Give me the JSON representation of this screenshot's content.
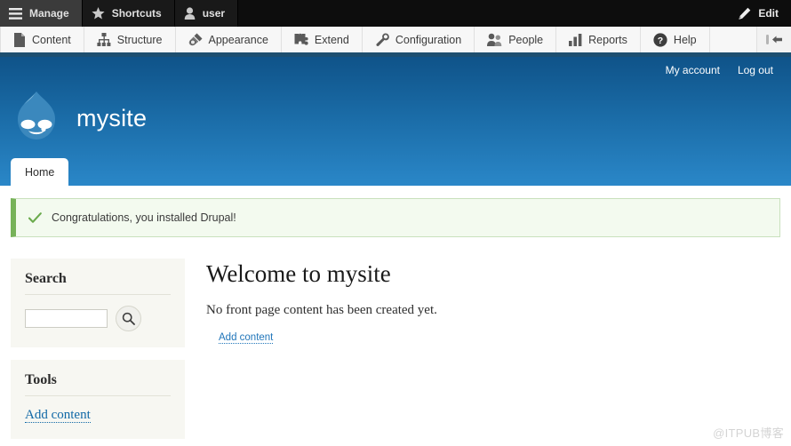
{
  "toolbar": {
    "tabs": [
      {
        "label": "Manage",
        "icon": "hamburger-icon",
        "active": true
      },
      {
        "label": "Shortcuts",
        "icon": "star-icon",
        "active": false
      },
      {
        "label": "user",
        "icon": "person-icon",
        "active": false
      }
    ],
    "edit_label": "Edit",
    "edit_icon": "pencil-icon"
  },
  "admin_menu": {
    "items": [
      {
        "label": "Content",
        "icon": "file-icon"
      },
      {
        "label": "Structure",
        "icon": "sitemap-icon"
      },
      {
        "label": "Appearance",
        "icon": "paintbrush-icon"
      },
      {
        "label": "Extend",
        "icon": "puzzle-piece-icon"
      },
      {
        "label": "Configuration",
        "icon": "wrench-icon"
      },
      {
        "label": "People",
        "icon": "people-icon"
      },
      {
        "label": "Reports",
        "icon": "bar-chart-icon"
      },
      {
        "label": "Help",
        "icon": "question-circle-icon"
      }
    ],
    "orientation_toggle_icon": "collapse-left-icon"
  },
  "site_header": {
    "site_name": "mysite",
    "logo_icon": "drupal-droplet-icon",
    "user_links": [
      {
        "label": "My account"
      },
      {
        "label": "Log out"
      }
    ],
    "tabs": [
      {
        "label": "Home",
        "active": true
      }
    ]
  },
  "status_message": {
    "icon": "checkmark-icon",
    "text": "Congratulations, you installed Drupal!"
  },
  "sidebar": {
    "search_block": {
      "title": "Search",
      "input_value": "",
      "input_placeholder": "",
      "button_icon": "magnifier-icon"
    },
    "tools_block": {
      "title": "Tools",
      "links": [
        {
          "label": "Add content"
        }
      ]
    }
  },
  "main": {
    "heading": "Welcome to mysite",
    "body_text": "No front page content has been created yet.",
    "action_link": "Add content"
  },
  "watermark": "@ITPUB博客",
  "colors": {
    "toolbar_dark": "#0d0d0d",
    "toolbar_active": "#3b3b3b",
    "menu_bg": "#f7f7f7",
    "menu_underline": "#1d4f70",
    "header_top": "#0f5389",
    "header_bottom": "#2a87c8",
    "status_green": "#77b259",
    "status_bg": "#f3faef",
    "link_blue": "#1068a6",
    "block_bg": "#f7f7f2"
  }
}
